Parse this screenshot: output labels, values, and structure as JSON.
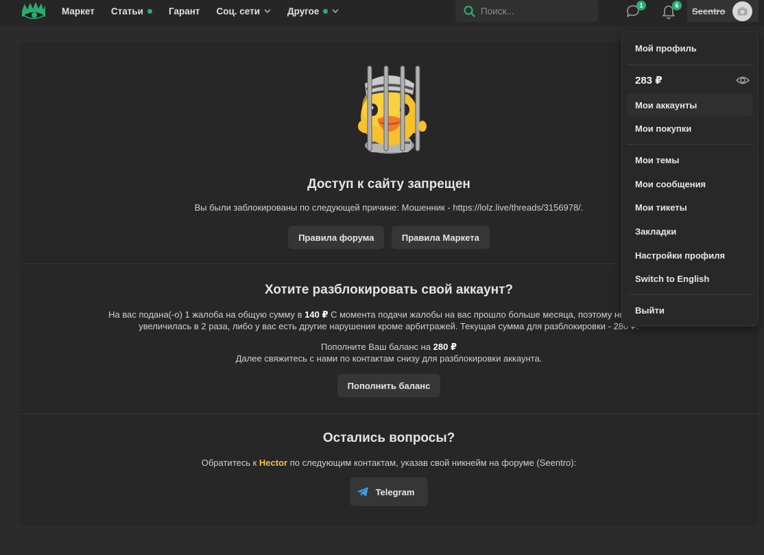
{
  "nav": {
    "items": [
      {
        "label": "Маркет",
        "dot": false,
        "chevron": false
      },
      {
        "label": "Статьи",
        "dot": true,
        "chevron": false
      },
      {
        "label": "Гарант",
        "dot": false,
        "chevron": false
      },
      {
        "label": "Соц. сети",
        "dot": false,
        "chevron": true
      },
      {
        "label": "Другое",
        "dot": true,
        "chevron": true
      }
    ]
  },
  "search": {
    "placeholder": "Поиск..."
  },
  "header": {
    "conversations_count": "1",
    "alerts_count": "6",
    "username": "Seentro"
  },
  "ban": {
    "title": "Доступ к сайту запрещен",
    "reason": "Вы были заблокированы по следующей причине: Мошенник - https://lolz.live/threads/3156978/.",
    "forum_rules_label": "Правила форума",
    "market_rules_label": "Правила Маркета"
  },
  "unlock": {
    "title": "Хотите разблокировать свой аккаунт?",
    "line1_a": "На вас подана(-о) 1 жалоба на общую сумму в ",
    "line1_amount": "140 ₽",
    "line1_b": " С момента подачи жалобы на вас прошло больше месяца, поэтому необходимая",
    "line2": "увеличилась в 2 раза, либо у вас есть другие нарушения кроме арбитражей. Текущая сумма для разблокировки - 280 ₽.",
    "topup_prefix": "Пополните Ваш баланс на ",
    "topup_amount": "280 ₽",
    "contact_line": "Далее свяжитесь с нами по контактам снизу для разблокировки аккаунта.",
    "topup_button": "Пополнить баланс"
  },
  "questions": {
    "title": "Остались вопросы?",
    "text_a": "Обратитесь к ",
    "contact_name": "Hector",
    "text_b": " по следующим контактам, указав свой никнейм на форуме (Seentro):",
    "telegram_label": "Telegram"
  },
  "dropdown": {
    "my_profile": "Мой профиль",
    "balance": "283 ₽",
    "my_accounts": "Мои аккаунты",
    "my_purchases": "Мои покупки",
    "my_threads": "Мои темы",
    "my_messages": "Мои сообщения",
    "my_tickets": "Мои тикеты",
    "bookmarks": "Закладки",
    "profile_settings": "Настройки профиля",
    "switch_language": "Switch to English",
    "logout": "Выйти"
  },
  "colors": {
    "accent": "#2bad72",
    "background": "#2b2b2b",
    "panel": "#272727",
    "highlight_name": "#f5c242"
  }
}
